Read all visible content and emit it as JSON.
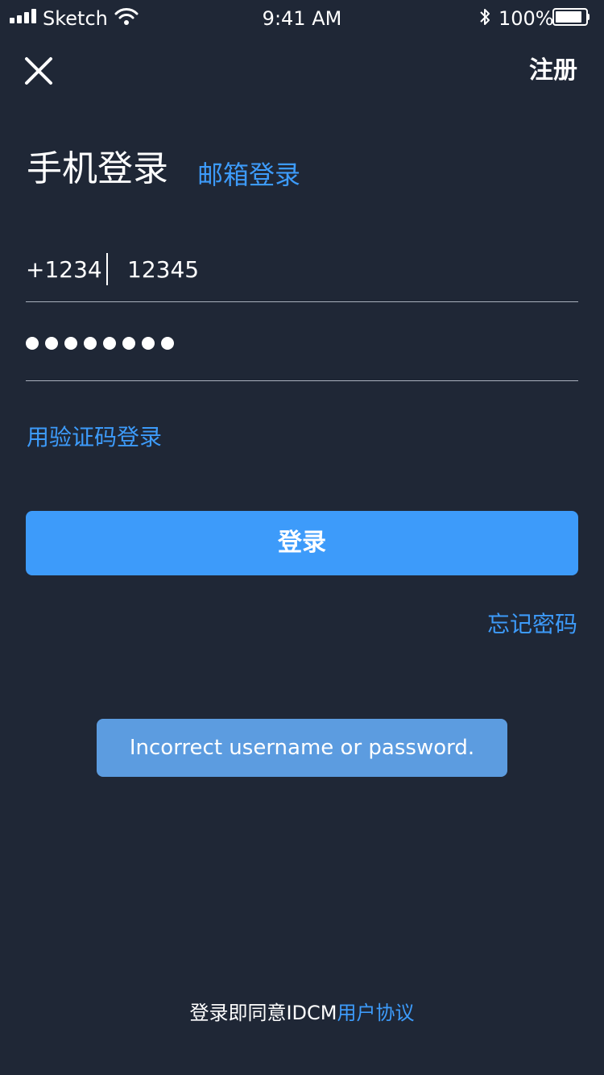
{
  "status_bar": {
    "carrier": "Sketch",
    "time": "9:41 AM",
    "battery": "100%",
    "battery_level": 1.0,
    "signal_bars": 4,
    "icons": [
      "signal-icon",
      "wifi-icon",
      "bluetooth-icon",
      "battery-icon"
    ]
  },
  "header": {
    "close_icon": "close-icon",
    "register_label": "注册"
  },
  "login": {
    "title": "手机登录",
    "email_tab_label": "邮箱登录",
    "country_code": "+1234",
    "phone_value": "12345",
    "password_mask": "●●●●●●●●",
    "sms_login_label": "用验证码登录",
    "submit_label": "登录",
    "forgot_label": "忘记密码"
  },
  "toast": {
    "message": "Incorrect username or password."
  },
  "footer": {
    "agreement_prefix": "登录即同意IDCM",
    "agreement_link": "用户协议"
  },
  "colors": {
    "background": "#1f2736",
    "accent": "#3d9bfa",
    "toast_bg": "#5c9ce0",
    "text": "#ffffff",
    "underline": "#a9b0bd"
  }
}
